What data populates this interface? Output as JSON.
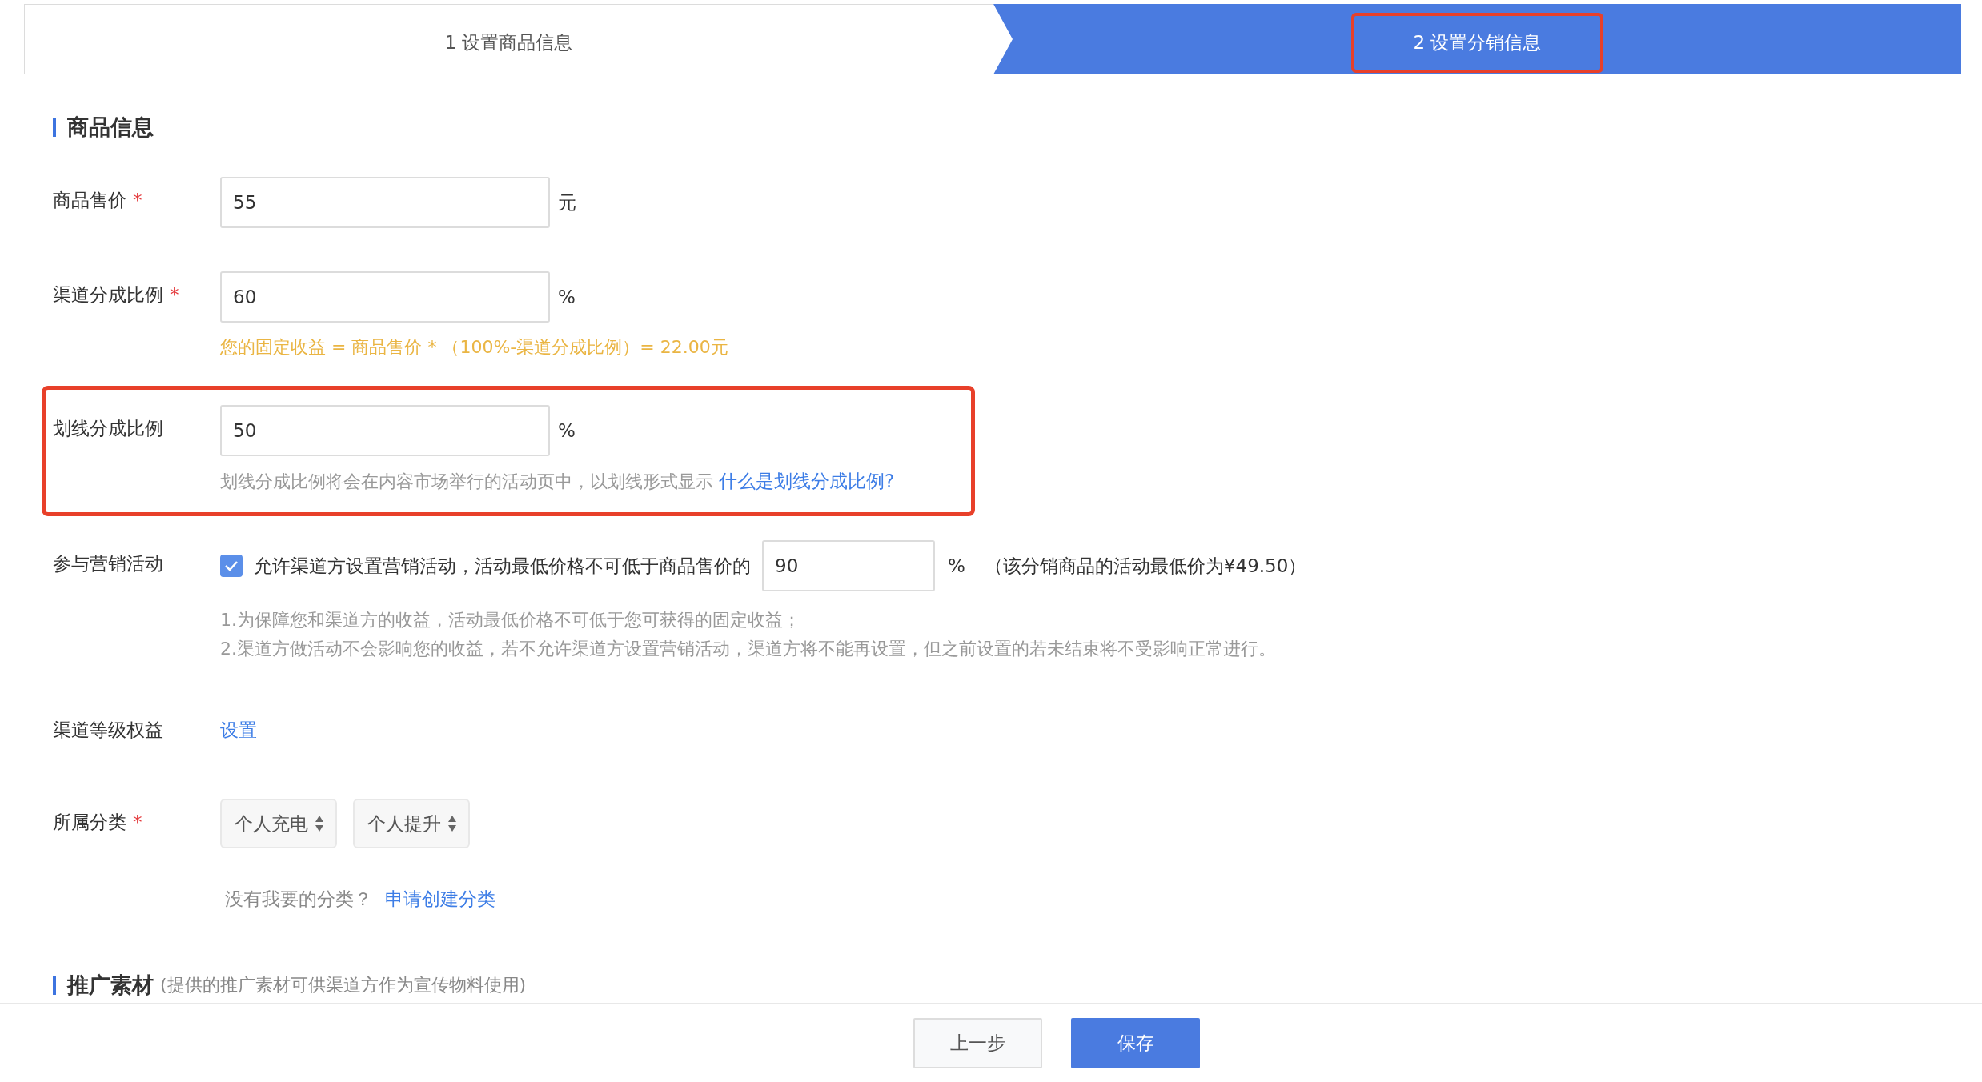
{
  "steps": [
    {
      "label": "1 设置商品信息",
      "selected": false,
      "highlighted": false
    },
    {
      "label": "2 设置分销信息",
      "selected": true,
      "highlighted": true
    }
  ],
  "section_title": "商品信息",
  "fields": [
    {
      "kind": "input",
      "label": "商品售价",
      "required_mark": "*",
      "value": "55",
      "unit": "元"
    },
    {
      "kind": "input",
      "label": "渠道分成比例",
      "required_mark": "*",
      "value": "60",
      "unit": "%",
      "hint": "您的固定收益 = 商品售价 * （100%-渠道分成比例）= 22.00元",
      "warning": true
    },
    {
      "kind": "input",
      "label": "划线分成比例",
      "value": "50",
      "unit": "%",
      "hint": "划线分成比例将会在内容市场举行的活动页中，以划线形式显示",
      "warning": false,
      "link": "什么是划线分成比例?",
      "highlighted": true
    },
    {
      "kind": "checkbox",
      "label": "参与营销活动",
      "checked": true,
      "text": "允许渠道方设置营销活动，活动最低价格不可低于商品售价的",
      "value": "90",
      "unit": "%",
      "note": "（该分销商品的活动最低价为¥49.50）",
      "notes": [
        "1.为保障您和渠道方的收益，活动最低价格不可低于您可获得的固定收益；",
        "2.渠道方做活动不会影响您的收益，若不允许渠道方设置营销活动，渠道方将不能再设置，但之前设置的若未结束将不受影响正常进行。"
      ]
    },
    {
      "kind": "link",
      "label": "渠道等级权益",
      "link": "设置"
    },
    {
      "kind": "selects",
      "label": "所属分类",
      "required_mark": "*",
      "options": [
        "个人充电",
        "个人提升"
      ],
      "helper": "没有我要的分类？",
      "link": "申请创建分类"
    }
  ],
  "next_section": {
    "title": "推广素材",
    "subtitle": "(提供的推广素材可供渠道方作为宣传物料使用)"
  },
  "buttons": [
    {
      "label": "上一步",
      "primary": false
    },
    {
      "label": "保存",
      "primary": true
    }
  ]
}
